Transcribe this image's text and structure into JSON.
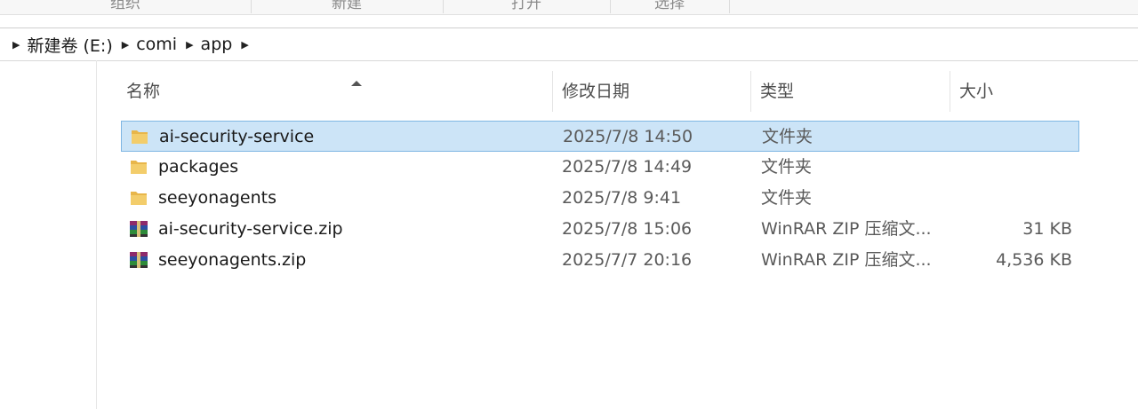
{
  "ribbon": {
    "groups": [
      "组织",
      "新建",
      "打开",
      "选择"
    ]
  },
  "address": {
    "crumbs": [
      "新建卷 (E:)",
      "comi",
      "app"
    ]
  },
  "list": {
    "columns": [
      "名称",
      "修改日期",
      "类型",
      "大小"
    ],
    "rows": [
      {
        "name": "ai-security-service",
        "date": "2025/7/8 14:50",
        "type": "文件夹",
        "size": "",
        "icon": "folder-icon",
        "selected": true
      },
      {
        "name": "packages",
        "date": "2025/7/8 14:49",
        "type": "文件夹",
        "size": "",
        "icon": "folder-icon",
        "selected": false
      },
      {
        "name": "seeyonagents",
        "date": "2025/7/8 9:41",
        "type": "文件夹",
        "size": "",
        "icon": "folder-icon",
        "selected": false
      },
      {
        "name": "ai-security-service.zip",
        "date": "2025/7/8 15:06",
        "type": "WinRAR ZIP 压缩文...",
        "size": "31 KB",
        "icon": "winrar-archive-icon",
        "selected": false
      },
      {
        "name": "seeyonagents.zip",
        "date": "2025/7/7 20:16",
        "type": "WinRAR ZIP 压缩文...",
        "size": "4,536 KB",
        "icon": "winrar-archive-icon",
        "selected": false
      }
    ]
  },
  "colors": {
    "selection_bg": "#cce4f7",
    "selection_border": "#7fb6e3",
    "folder": "#e8b64a"
  }
}
